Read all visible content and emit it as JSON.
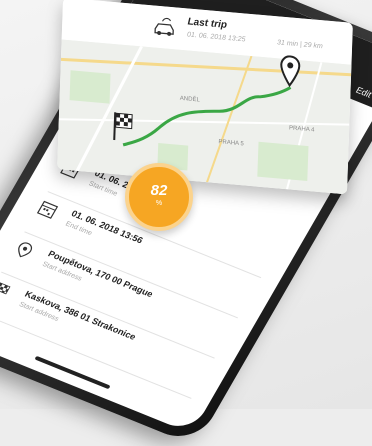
{
  "header": {
    "edit_label": "Edit"
  },
  "trip": {
    "title": "Last trip",
    "date": "01. 06. 2018  13:25",
    "duration": "31 min | 29 km",
    "map_labels": [
      "ANDĚL",
      "PRAHA 5",
      "PRAHA 4"
    ]
  },
  "score": {
    "value": "82",
    "unit": "%",
    "color": "#f6a623"
  },
  "details": [
    {
      "icon": "calendar-icon",
      "value": "01. 06. 2018  13:25",
      "label": "Start time"
    },
    {
      "icon": "calendar-icon",
      "value": "01. 06. 2018  13:56",
      "label": "End time"
    },
    {
      "icon": "location-pin-icon",
      "value": "Poupětova, 170 00 Prague",
      "label": "Start address"
    },
    {
      "icon": "checkered-flag-icon",
      "value": "Kaskova, 386 01 Strakonice",
      "label": "Start address"
    }
  ],
  "colors": {
    "route": "#3aa745",
    "accent": "#f6a623"
  }
}
